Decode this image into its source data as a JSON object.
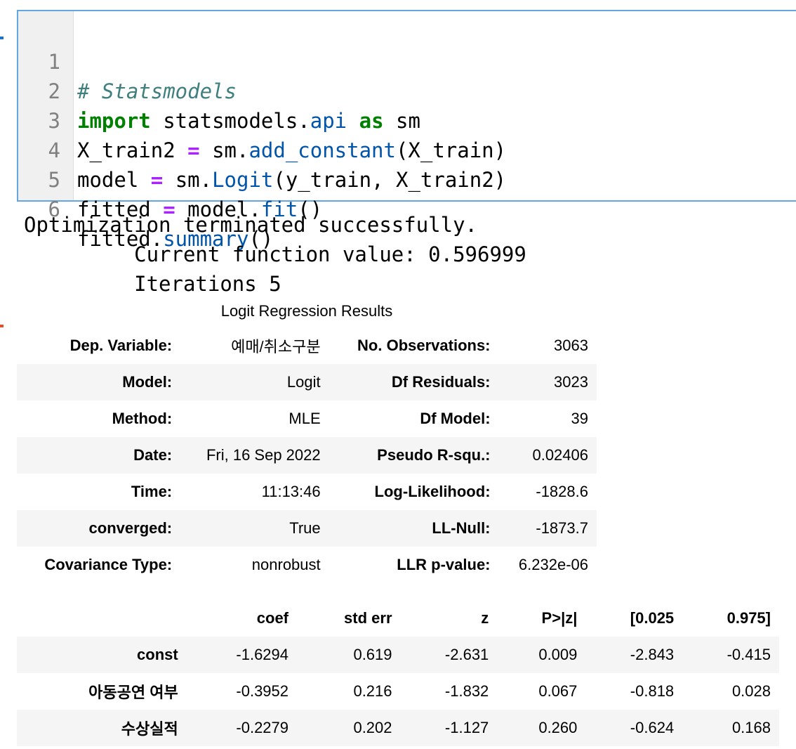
{
  "code_cell": {
    "lines": [
      {
        "no": "1",
        "text": "# Statsmodels"
      },
      {
        "no": "2",
        "kw1": "import",
        "t1": " statsmodels.",
        "attr1": "api",
        "t2": " ",
        "kw2": "as",
        "t3": " sm"
      },
      {
        "no": "3",
        "t1": "X_train2 ",
        "op": "=",
        "t2": " sm.",
        "attr": "add_constant",
        "t3": "(X_train)"
      },
      {
        "no": "4",
        "t1": "model ",
        "op": "=",
        "t2": " sm.",
        "attr": "Logit",
        "t3": "(y_train, X_train2)"
      },
      {
        "no": "5",
        "t1": "fitted ",
        "op": "=",
        "t2": " model.",
        "attr": "fit",
        "t3": "()"
      },
      {
        "no": "6",
        "t1": "fitted.",
        "attr": "summary",
        "t2": "()"
      }
    ]
  },
  "stdout": {
    "line1": "Optimization terminated successfully.",
    "line2": "         Current function value: 0.596999",
    "line3": "         Iterations 5"
  },
  "results": {
    "caption": "Logit Regression Results",
    "rows": [
      {
        "l1": "Dep. Variable:",
        "v1": "예매/취소구분",
        "l2": "No. Observations:",
        "v2": "3063"
      },
      {
        "l1": "Model:",
        "v1": "Logit",
        "l2": "Df Residuals:",
        "v2": "3023"
      },
      {
        "l1": "Method:",
        "v1": "MLE",
        "l2": "Df Model:",
        "v2": "39"
      },
      {
        "l1": "Date:",
        "v1": "Fri, 16 Sep 2022",
        "l2": "Pseudo R-squ.:",
        "v2": "0.02406"
      },
      {
        "l1": "Time:",
        "v1": "11:13:46",
        "l2": "Log-Likelihood:",
        "v2": "-1828.6"
      },
      {
        "l1": "converged:",
        "v1": "True",
        "l2": "LL-Null:",
        "v2": "-1873.7"
      },
      {
        "l1": "Covariance Type:",
        "v1": "nonrobust",
        "l2": "LLR p-value:",
        "v2": "6.232e-06"
      }
    ]
  },
  "coefficients": {
    "headers": [
      "",
      "coef",
      "std err",
      "z",
      "P>|z|",
      "[0.025",
      "0.975]"
    ],
    "rows": [
      {
        "name": "const",
        "coef": "-1.6294",
        "se": "0.619",
        "z": "-2.631",
        "p": "0.009",
        "lo": "-2.843",
        "hi": "-0.415"
      },
      {
        "name": "아동공연 여부",
        "coef": "-0.3952",
        "se": "0.216",
        "z": "-1.832",
        "p": "0.067",
        "lo": "-0.818",
        "hi": "0.028"
      },
      {
        "name": "수상실적",
        "coef": "-0.2279",
        "se": "0.202",
        "z": "-1.127",
        "p": "0.260",
        "lo": "-0.624",
        "hi": "0.168"
      }
    ]
  }
}
